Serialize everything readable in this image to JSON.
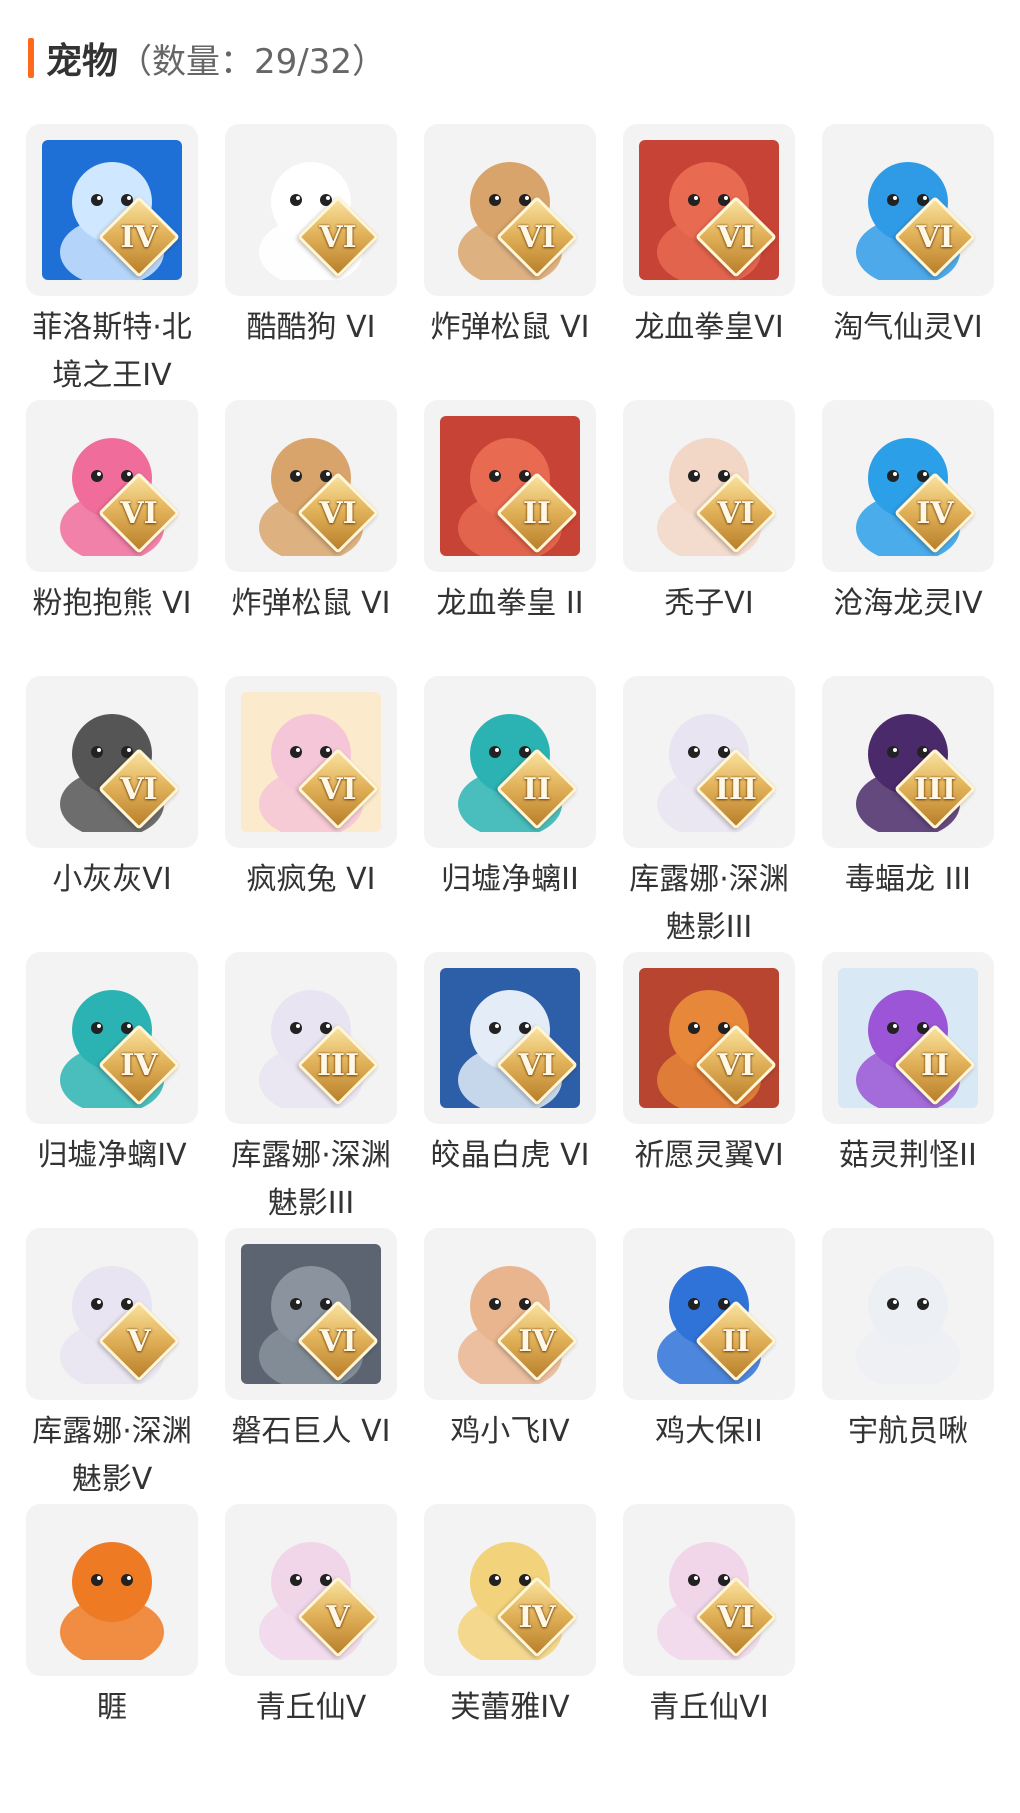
{
  "header": {
    "title": "宠物",
    "count_text": "（数量：29/32）"
  },
  "pets": [
    {
      "name": "菲洛斯特·北境之王IV",
      "badge": "IV",
      "bg": "#1e6fd6",
      "fg": "#cfe8ff",
      "icon": "ice-dragon-king"
    },
    {
      "name": "酷酷狗 VI",
      "badge": "VI",
      "bg": "#f3f3f3",
      "fg": "#ffffff",
      "icon": "goggles-dog"
    },
    {
      "name": "炸弹松鼠 VI",
      "badge": "VI",
      "bg": "#f3f3f3",
      "fg": "#d9a46b",
      "icon": "bomb-squirrel"
    },
    {
      "name": "龙血拳皇VI",
      "badge": "VI",
      "bg": "#c74336",
      "fg": "#e86a50",
      "icon": "red-dragon"
    },
    {
      "name": "淘气仙灵VI",
      "badge": "VI",
      "bg": "#f3f3f3",
      "fg": "#2f9be6",
      "icon": "blue-spirit-dog"
    },
    {
      "name": "粉抱抱熊 VI",
      "badge": "VI",
      "bg": "#f3f3f3",
      "fg": "#f06c9b",
      "icon": "pink-bear"
    },
    {
      "name": "炸弹松鼠 VI",
      "badge": "VI",
      "bg": "#f3f3f3",
      "fg": "#d9a46b",
      "icon": "bomb-squirrel"
    },
    {
      "name": "龙血拳皇 II",
      "badge": "II",
      "bg": "#c74336",
      "fg": "#e86a50",
      "icon": "red-dragon"
    },
    {
      "name": "秃子VI",
      "badge": "VI",
      "bg": "#f3f3f3",
      "fg": "#f2d6c6",
      "icon": "bald-head"
    },
    {
      "name": "沧海龙灵IV",
      "badge": "IV",
      "bg": "#f3f3f3",
      "fg": "#2b9fe8",
      "icon": "sea-dragon-girl"
    },
    {
      "name": "小灰灰VI",
      "badge": "VI",
      "bg": "#f3f3f3",
      "fg": "#555555",
      "icon": "grey-wolf"
    },
    {
      "name": "疯疯兔 VI",
      "badge": "VI",
      "bg": "#fbeacb",
      "fg": "#f5c6d7",
      "icon": "crazy-rabbit"
    },
    {
      "name": "归墟净螭II",
      "badge": "II",
      "bg": "#f3f3f3",
      "fg": "#2bb3b3",
      "icon": "teal-dragon"
    },
    {
      "name": "库露娜·深渊魅影III",
      "badge": "III",
      "bg": "#f3f3f3",
      "fg": "#e8e4f2",
      "icon": "abyss-girl"
    },
    {
      "name": "毒蝠龙 III",
      "badge": "III",
      "bg": "#f3f3f3",
      "fg": "#4a2a6a",
      "icon": "poison-bat-dragon"
    },
    {
      "name": "归墟净螭IV",
      "badge": "IV",
      "bg": "#f3f3f3",
      "fg": "#2bb3b3",
      "icon": "teal-dragon"
    },
    {
      "name": "库露娜·深渊魅影III",
      "badge": "III",
      "bg": "#f3f3f3",
      "fg": "#e8e4f2",
      "icon": "abyss-girl"
    },
    {
      "name": "皎晶白虎 VI",
      "badge": "VI",
      "bg": "#2d5fa8",
      "fg": "#e3ecf7",
      "icon": "white-tiger"
    },
    {
      "name": "祈愿灵翼VI",
      "badge": "VI",
      "bg": "#b7452f",
      "fg": "#e6873a",
      "icon": "wish-bird"
    },
    {
      "name": "菇灵荆怪II",
      "badge": "II",
      "bg": "#d8e8f5",
      "fg": "#9b55d6",
      "icon": "mushroom-imp"
    },
    {
      "name": "库露娜·深渊魅影V",
      "badge": "V",
      "bg": "#f3f3f3",
      "fg": "#e8e4f2",
      "icon": "abyss-girl"
    },
    {
      "name": "磐石巨人 VI",
      "badge": "VI",
      "bg": "#5b6470",
      "fg": "#8a939e",
      "icon": "rock-giant"
    },
    {
      "name": "鸡小飞IV",
      "badge": "IV",
      "bg": "#f3f3f3",
      "fg": "#e9b58f",
      "icon": "muscle-chick"
    },
    {
      "name": "鸡大保II",
      "badge": "II",
      "bg": "#f3f3f3",
      "fg": "#2f73d8",
      "icon": "blue-chick-sunglasses"
    },
    {
      "name": "宇航员啾",
      "badge": "",
      "bg": "#f3f3f3",
      "fg": "#eceff3",
      "icon": "astronaut-cow"
    },
    {
      "name": "睚",
      "badge": "",
      "bg": "#f3f3f3",
      "fg": "#ee7a23",
      "icon": "fire-dragon"
    },
    {
      "name": "青丘仙V",
      "badge": "V",
      "bg": "#f3f3f3",
      "fg": "#f1d6ea",
      "icon": "fox-fairy"
    },
    {
      "name": "芙蕾雅IV",
      "badge": "IV",
      "bg": "#f3f3f3",
      "fg": "#f2d27b",
      "icon": "golden-valkyrie"
    },
    {
      "name": "青丘仙VI",
      "badge": "VI",
      "bg": "#f3f3f3",
      "fg": "#f1d6ea",
      "icon": "fox-fairy"
    }
  ]
}
